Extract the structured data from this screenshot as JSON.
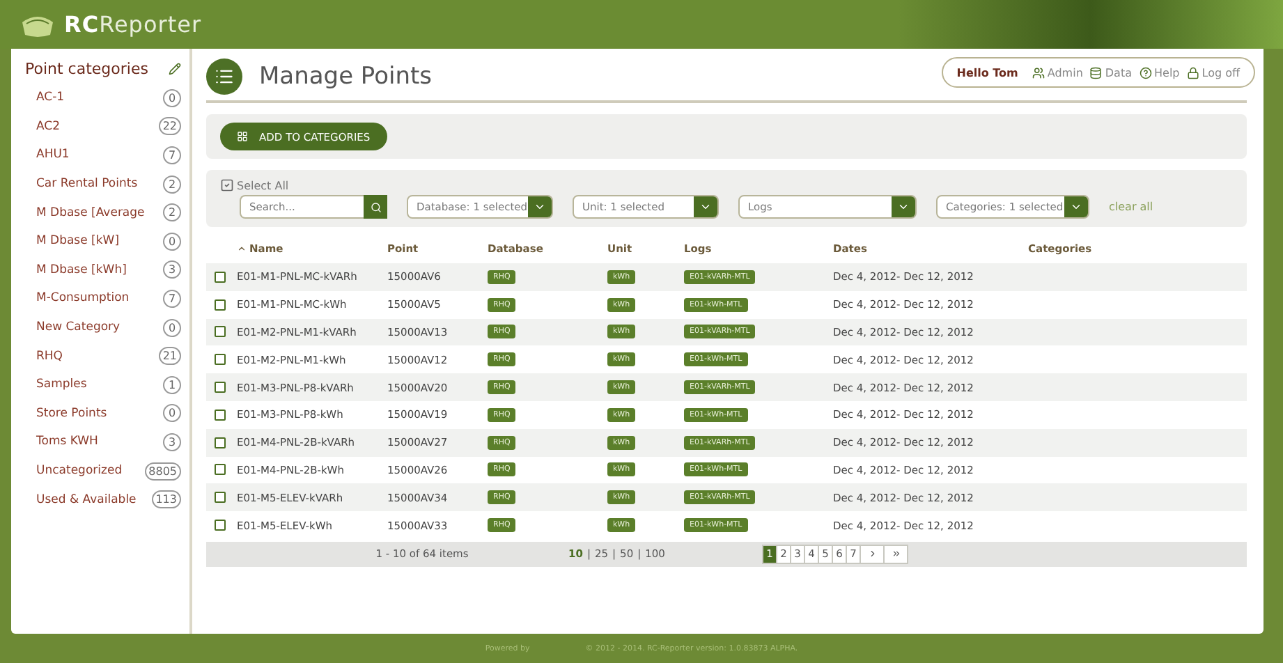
{
  "app": {
    "logo": "**RC**Reporter"
  },
  "sidebar": {
    "title": "Point categories",
    "items": [
      {
        "name": "AC-1",
        "count": "0"
      },
      {
        "name": "AC2",
        "count": "22"
      },
      {
        "name": "AHU1",
        "count": "7"
      },
      {
        "name": "Car Rental Points",
        "count": "2"
      },
      {
        "name": "M Dbase [Average",
        "count": "2"
      },
      {
        "name": "M Dbase [kW]",
        "count": "0"
      },
      {
        "name": "M Dbase [kWh]",
        "count": "3"
      },
      {
        "name": "M-Consumption",
        "count": "7"
      },
      {
        "name": "New Category",
        "count": "0"
      },
      {
        "name": "RHQ",
        "count": "21"
      },
      {
        "name": "Samples",
        "count": "1"
      },
      {
        "name": "Store Points",
        "count": "0"
      },
      {
        "name": "Toms KWH",
        "count": "3"
      },
      {
        "name": "Uncategorized",
        "count": "8805"
      },
      {
        "name": "Used & Available",
        "count": "113"
      }
    ]
  },
  "page": {
    "title": "Manage Points"
  },
  "user_menu": {
    "greeting": "Hello Tom",
    "links": [
      {
        "kind": "admin",
        "label": "Admin"
      },
      {
        "kind": "data",
        "label": "Data"
      },
      {
        "kind": "help",
        "label": "Help"
      },
      {
        "kind": "logoff",
        "label": "Log off"
      }
    ]
  },
  "toolbar": {
    "button": "ADD TO CATEGORIES"
  },
  "filters": {
    "select_all": "Select All",
    "search": {
      "placeholder": "Search..."
    },
    "dropdowns": [
      "Database: 1 selected",
      "Unit: 1 selected",
      "Logs",
      "Categories: 1 selected"
    ],
    "clear": "clear all"
  },
  "table": {
    "columns": [
      "Name",
      "Point",
      "Database",
      "Unit",
      "Logs",
      "Dates",
      "Categories"
    ],
    "rows": [
      {
        "checked": false,
        "name": "E01-M1-PNL-MC-kVARh",
        "point": "15000AV6",
        "database": "RHQ",
        "unit": "kWh",
        "logs": "E01-kVARh-MTL",
        "dates": "Dec 4, 2012- Dec 12, 2012"
      },
      {
        "checked": false,
        "name": "E01-M1-PNL-MC-kWh",
        "point": "15000AV5",
        "database": "RHQ",
        "unit": "kWh",
        "logs": "E01-kWh-MTL",
        "dates": "Dec 4, 2012- Dec 12, 2012"
      },
      {
        "checked": false,
        "name": "E01-M2-PNL-M1-kVARh",
        "point": "15000AV13",
        "database": "RHQ",
        "unit": "kWh",
        "logs": "E01-kVARh-MTL",
        "dates": "Dec 4, 2012- Dec 12, 2012"
      },
      {
        "checked": false,
        "name": "E01-M2-PNL-M1-kWh",
        "point": "15000AV12",
        "database": "RHQ",
        "unit": "kWh",
        "logs": "E01-kWh-MTL",
        "dates": "Dec 4, 2012- Dec 12, 2012"
      },
      {
        "checked": false,
        "name": "E01-M3-PNL-P8-kVARh",
        "point": "15000AV20",
        "database": "RHQ",
        "unit": "kWh",
        "logs": "E01-kVARh-MTL",
        "dates": "Dec 4, 2012- Dec 12, 2012"
      },
      {
        "checked": false,
        "name": "E01-M3-PNL-P8-kWh",
        "point": "15000AV19",
        "database": "RHQ",
        "unit": "kWh",
        "logs": "E01-kWh-MTL",
        "dates": "Dec 4, 2012- Dec 12, 2012"
      },
      {
        "checked": false,
        "name": "E01-M4-PNL-2B-kVARh",
        "point": "15000AV27",
        "database": "RHQ",
        "unit": "kWh",
        "logs": "E01-kVARh-MTL",
        "dates": "Dec 4, 2012- Dec 12, 2012"
      },
      {
        "checked": false,
        "name": "E01-M4-PNL-2B-kWh",
        "point": "15000AV26",
        "database": "RHQ",
        "unit": "kWh",
        "logs": "E01-kWh-MTL",
        "dates": "Dec 4, 2012- Dec 12, 2012"
      },
      {
        "checked": false,
        "name": "E01-M5-ELEV-kVARh",
        "point": "15000AV34",
        "database": "RHQ",
        "unit": "kWh",
        "logs": "E01-kVARh-MTL",
        "dates": "Dec 4, 2012- Dec 12, 2012"
      },
      {
        "checked": false,
        "name": "E01-M5-ELEV-kWh",
        "point": "15000AV33",
        "database": "RHQ",
        "unit": "kWh",
        "logs": "E01-kWh-MTL",
        "dates": "Dec 4, 2012- Dec 12, 2012"
      }
    ]
  },
  "pager": {
    "summary": "1 - 10 of 64 items",
    "separator": "|",
    "page_sizes": [
      {
        "label": "10",
        "selected": true
      },
      {
        "label": "25",
        "selected": false
      },
      {
        "label": "50",
        "selected": false
      },
      {
        "label": "100",
        "selected": false
      }
    ],
    "pages": [
      {
        "label": "1",
        "selected": true
      },
      {
        "label": "2",
        "selected": false
      },
      {
        "label": "3",
        "selected": false
      },
      {
        "label": "4",
        "selected": false
      },
      {
        "label": "5",
        "selected": false
      },
      {
        "label": "6",
        "selected": false
      },
      {
        "label": "7",
        "selected": false
      }
    ]
  },
  "footer": {
    "powered": "Powered by",
    "copyright": "© 2012 - 2014. RC-Reporter version: 1.0.83873 ALPHA."
  }
}
